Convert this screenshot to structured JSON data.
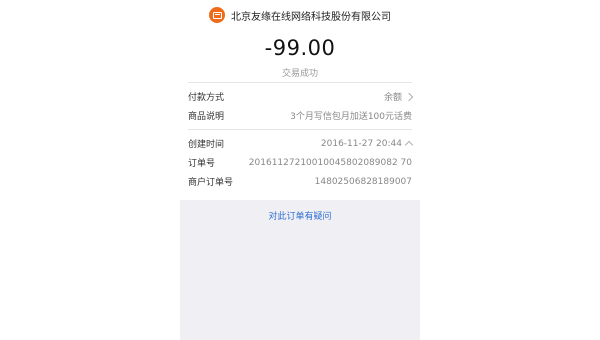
{
  "merchant": {
    "name": "北京友缘在线网络科技股份有限公司",
    "icon": "store-icon"
  },
  "transaction": {
    "amount": "-99.00",
    "status": "交易成功"
  },
  "details": [
    {
      "label": "付款方式",
      "value": "余额",
      "icon": "chevron-right-icon"
    },
    {
      "label": "商品说明",
      "value": "3个月写信包月加送100元话费"
    }
  ],
  "order": [
    {
      "label": "创建时间",
      "value": "2016-11-27 20:44",
      "icon": "chevron-up-icon"
    },
    {
      "label": "订单号",
      "value": "20161127210010045802089082 70"
    },
    {
      "label": "商户订单号",
      "value": "14802506828189007"
    }
  ],
  "actions": {
    "question_link": "对此订单有疑问"
  },
  "colors": {
    "accent": "#ef6a1a",
    "link": "#2f6fd1",
    "background_gray": "#f0f0f4"
  }
}
